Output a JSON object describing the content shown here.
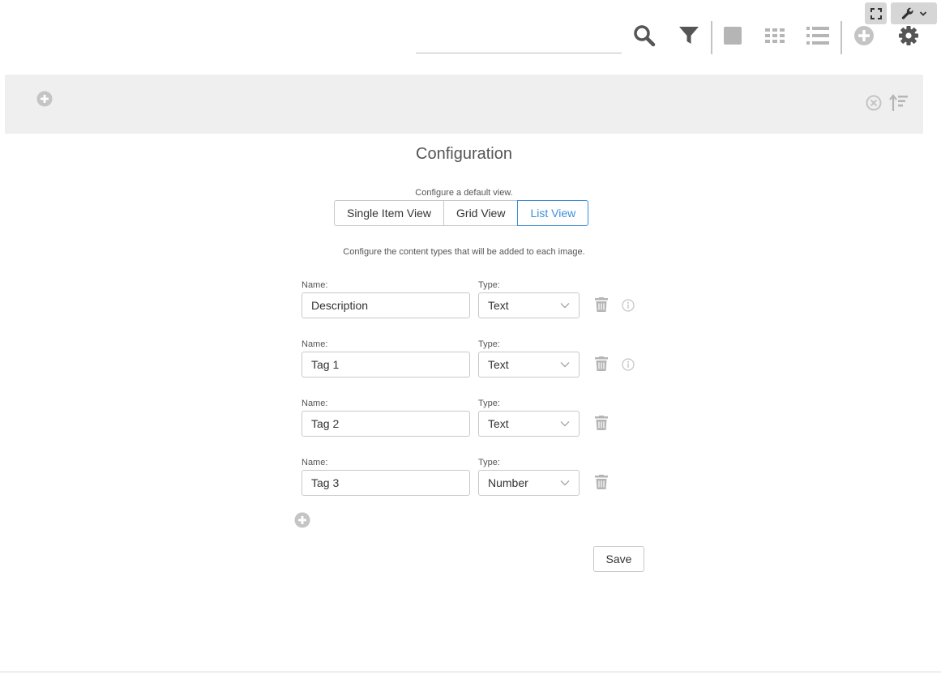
{
  "toolbar": {
    "search": {
      "value": "",
      "placeholder": ""
    },
    "icons": [
      "search-icon",
      "filter-icon",
      "single-item-view-icon",
      "grid-view-icon",
      "list-view-icon",
      "add-icon",
      "gear-icon"
    ]
  },
  "corner": {
    "icons": [
      "fullscreen-icon",
      "wrench-icon",
      "chevron-down-icon"
    ]
  },
  "header_bar": {
    "icons": [
      "add-icon",
      "clear-icon",
      "sort-icon"
    ]
  },
  "config": {
    "title": "Configuration",
    "view_caption": "Configure a default view.",
    "views": [
      {
        "label": "Single Item View",
        "active": false
      },
      {
        "label": "Grid View",
        "active": false
      },
      {
        "label": "List View",
        "active": true
      }
    ],
    "content_caption": "Configure the content types that will be added to each image.",
    "name_label": "Name:",
    "type_label": "Type:",
    "fields": [
      {
        "name": "Description",
        "type": "Text",
        "has_info": true
      },
      {
        "name": "Tag 1",
        "type": "Text",
        "has_info": true
      },
      {
        "name": "Tag 2",
        "type": "Text",
        "has_info": false
      },
      {
        "name": "Tag 3",
        "type": "Number",
        "has_info": false
      }
    ],
    "save_label": "Save"
  },
  "colors": {
    "accent": "#3d8fd8",
    "icon_dark": "#555555",
    "icon_light": "#b5b5b5",
    "header_bg": "#efefef"
  }
}
